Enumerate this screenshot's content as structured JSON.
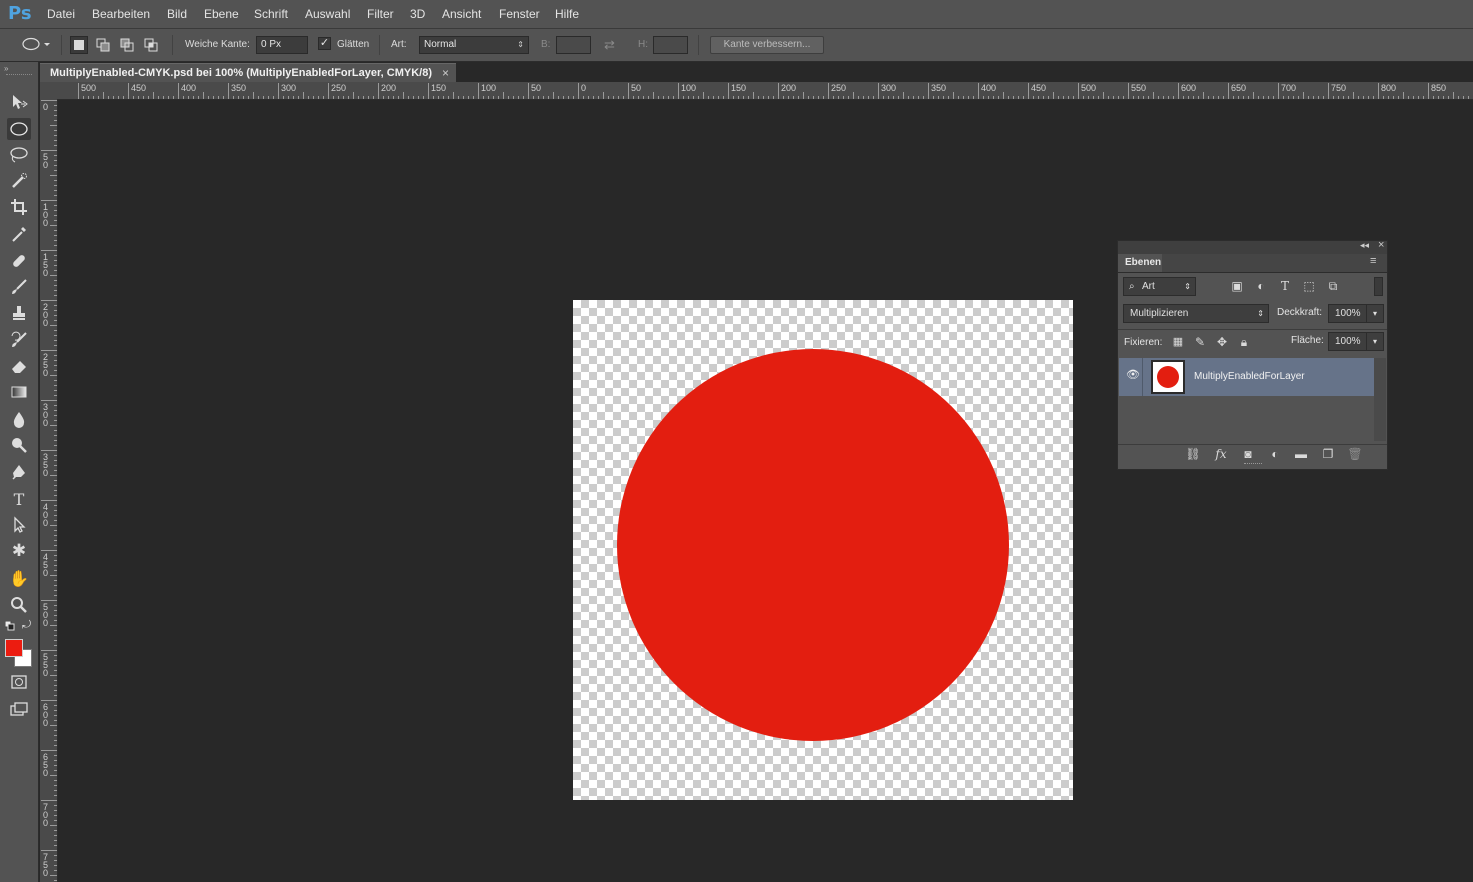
{
  "app": {
    "logo": "Ps"
  },
  "menu": [
    "Datei",
    "Bearbeiten",
    "Bild",
    "Ebene",
    "Schrift",
    "Auswahl",
    "Filter",
    "3D",
    "Ansicht",
    "Fenster",
    "Hilfe"
  ],
  "options": {
    "feather_label": "Weiche Kante:",
    "feather_value": "0 Px",
    "antialias_label": "Glätten",
    "antialias_checked": true,
    "style_label": "Art:",
    "style_value": "Normal",
    "width_label": "B:",
    "height_label": "H:",
    "refine_edge_label": "Kante verbessern..."
  },
  "document": {
    "tab_title": "MultiplyEnabled-CMYK.psd bei 100% (MultiplyEnabledForLayer, CMYK/8)",
    "close_glyph": "×"
  },
  "rulers": {
    "top": [
      "500",
      "450",
      "400",
      "350",
      "300",
      "250",
      "200",
      "150",
      "100",
      "50",
      "0",
      "50",
      "100",
      "150",
      "200",
      "250",
      "300",
      "350",
      "400",
      "450",
      "500",
      "550",
      "600",
      "650",
      "700",
      "750",
      "800",
      "850"
    ],
    "left": [
      "0",
      "50",
      "100",
      "150",
      "200",
      "250",
      "300",
      "350",
      "400",
      "450",
      "500",
      "550",
      "600",
      "650",
      "700",
      "750"
    ]
  },
  "tools": [
    "move-tool-icon",
    "elliptical-marquee-tool-icon",
    "lasso-tool-icon",
    "quick-selection-tool-icon",
    "crop-tool-icon",
    "eyedropper-tool-icon",
    "healing-brush-tool-icon",
    "brush-tool-icon",
    "clone-stamp-tool-icon",
    "history-brush-tool-icon",
    "eraser-tool-icon",
    "gradient-tool-icon",
    "blur-tool-icon",
    "dodge-tool-icon",
    "pen-tool-icon",
    "type-tool-icon",
    "path-selection-tool-icon",
    "custom-shape-tool-icon",
    "hand-tool-icon",
    "zoom-tool-icon"
  ],
  "colors": {
    "foreground": "#ec1c10",
    "background": "#ffffff",
    "shape_fill": "#e31e10",
    "layer_selected": "#667389"
  },
  "layers_panel": {
    "tab_label": "Ebenen",
    "filter_label": "Art",
    "blend_mode": "Multiplizieren",
    "opacity_label": "Deckkraft:",
    "opacity_value": "100%",
    "lock_label": "Fixieren:",
    "fill_label": "Fläche:",
    "fill_value": "100%",
    "layers": [
      {
        "name": "MultiplyEnabledForLayer",
        "visible": true,
        "selected": true
      }
    ]
  }
}
